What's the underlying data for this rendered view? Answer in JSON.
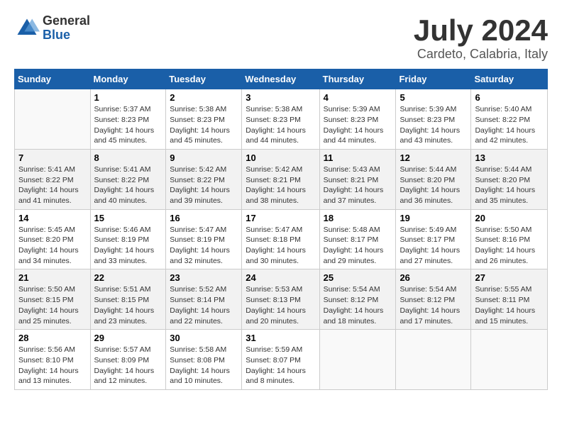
{
  "logo": {
    "general": "General",
    "blue": "Blue"
  },
  "title": "July 2024",
  "location": "Cardeto, Calabria, Italy",
  "headers": [
    "Sunday",
    "Monday",
    "Tuesday",
    "Wednesday",
    "Thursday",
    "Friday",
    "Saturday"
  ],
  "weeks": [
    [
      {
        "num": "",
        "info": ""
      },
      {
        "num": "1",
        "info": "Sunrise: 5:37 AM\nSunset: 8:23 PM\nDaylight: 14 hours\nand 45 minutes."
      },
      {
        "num": "2",
        "info": "Sunrise: 5:38 AM\nSunset: 8:23 PM\nDaylight: 14 hours\nand 45 minutes."
      },
      {
        "num": "3",
        "info": "Sunrise: 5:38 AM\nSunset: 8:23 PM\nDaylight: 14 hours\nand 44 minutes."
      },
      {
        "num": "4",
        "info": "Sunrise: 5:39 AM\nSunset: 8:23 PM\nDaylight: 14 hours\nand 44 minutes."
      },
      {
        "num": "5",
        "info": "Sunrise: 5:39 AM\nSunset: 8:23 PM\nDaylight: 14 hours\nand 43 minutes."
      },
      {
        "num": "6",
        "info": "Sunrise: 5:40 AM\nSunset: 8:22 PM\nDaylight: 14 hours\nand 42 minutes."
      }
    ],
    [
      {
        "num": "7",
        "info": "Sunrise: 5:41 AM\nSunset: 8:22 PM\nDaylight: 14 hours\nand 41 minutes."
      },
      {
        "num": "8",
        "info": "Sunrise: 5:41 AM\nSunset: 8:22 PM\nDaylight: 14 hours\nand 40 minutes."
      },
      {
        "num": "9",
        "info": "Sunrise: 5:42 AM\nSunset: 8:22 PM\nDaylight: 14 hours\nand 39 minutes."
      },
      {
        "num": "10",
        "info": "Sunrise: 5:42 AM\nSunset: 8:21 PM\nDaylight: 14 hours\nand 38 minutes."
      },
      {
        "num": "11",
        "info": "Sunrise: 5:43 AM\nSunset: 8:21 PM\nDaylight: 14 hours\nand 37 minutes."
      },
      {
        "num": "12",
        "info": "Sunrise: 5:44 AM\nSunset: 8:20 PM\nDaylight: 14 hours\nand 36 minutes."
      },
      {
        "num": "13",
        "info": "Sunrise: 5:44 AM\nSunset: 8:20 PM\nDaylight: 14 hours\nand 35 minutes."
      }
    ],
    [
      {
        "num": "14",
        "info": "Sunrise: 5:45 AM\nSunset: 8:20 PM\nDaylight: 14 hours\nand 34 minutes."
      },
      {
        "num": "15",
        "info": "Sunrise: 5:46 AM\nSunset: 8:19 PM\nDaylight: 14 hours\nand 33 minutes."
      },
      {
        "num": "16",
        "info": "Sunrise: 5:47 AM\nSunset: 8:19 PM\nDaylight: 14 hours\nand 32 minutes."
      },
      {
        "num": "17",
        "info": "Sunrise: 5:47 AM\nSunset: 8:18 PM\nDaylight: 14 hours\nand 30 minutes."
      },
      {
        "num": "18",
        "info": "Sunrise: 5:48 AM\nSunset: 8:17 PM\nDaylight: 14 hours\nand 29 minutes."
      },
      {
        "num": "19",
        "info": "Sunrise: 5:49 AM\nSunset: 8:17 PM\nDaylight: 14 hours\nand 27 minutes."
      },
      {
        "num": "20",
        "info": "Sunrise: 5:50 AM\nSunset: 8:16 PM\nDaylight: 14 hours\nand 26 minutes."
      }
    ],
    [
      {
        "num": "21",
        "info": "Sunrise: 5:50 AM\nSunset: 8:15 PM\nDaylight: 14 hours\nand 25 minutes."
      },
      {
        "num": "22",
        "info": "Sunrise: 5:51 AM\nSunset: 8:15 PM\nDaylight: 14 hours\nand 23 minutes."
      },
      {
        "num": "23",
        "info": "Sunrise: 5:52 AM\nSunset: 8:14 PM\nDaylight: 14 hours\nand 22 minutes."
      },
      {
        "num": "24",
        "info": "Sunrise: 5:53 AM\nSunset: 8:13 PM\nDaylight: 14 hours\nand 20 minutes."
      },
      {
        "num": "25",
        "info": "Sunrise: 5:54 AM\nSunset: 8:12 PM\nDaylight: 14 hours\nand 18 minutes."
      },
      {
        "num": "26",
        "info": "Sunrise: 5:54 AM\nSunset: 8:12 PM\nDaylight: 14 hours\nand 17 minutes."
      },
      {
        "num": "27",
        "info": "Sunrise: 5:55 AM\nSunset: 8:11 PM\nDaylight: 14 hours\nand 15 minutes."
      }
    ],
    [
      {
        "num": "28",
        "info": "Sunrise: 5:56 AM\nSunset: 8:10 PM\nDaylight: 14 hours\nand 13 minutes."
      },
      {
        "num": "29",
        "info": "Sunrise: 5:57 AM\nSunset: 8:09 PM\nDaylight: 14 hours\nand 12 minutes."
      },
      {
        "num": "30",
        "info": "Sunrise: 5:58 AM\nSunset: 8:08 PM\nDaylight: 14 hours\nand 10 minutes."
      },
      {
        "num": "31",
        "info": "Sunrise: 5:59 AM\nSunset: 8:07 PM\nDaylight: 14 hours\nand 8 minutes."
      },
      {
        "num": "",
        "info": ""
      },
      {
        "num": "",
        "info": ""
      },
      {
        "num": "",
        "info": ""
      }
    ]
  ]
}
